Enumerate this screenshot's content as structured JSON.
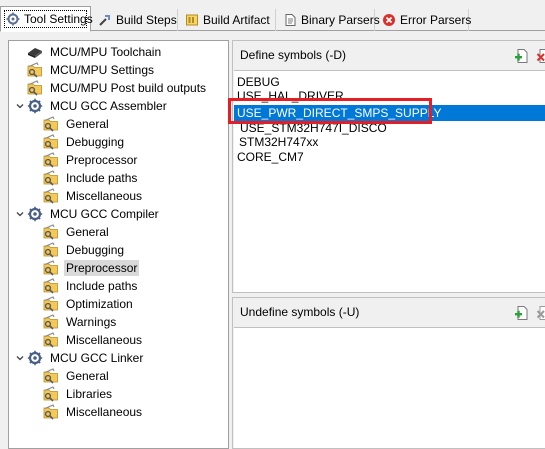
{
  "tabs": [
    {
      "label": "Tool Settings",
      "icon": "tool-settings-icon",
      "active": true
    },
    {
      "label": "Build Steps",
      "icon": "build-steps-icon",
      "active": false
    },
    {
      "label": "Build Artifact",
      "icon": "build-artifact-icon",
      "active": false
    },
    {
      "label": "Binary Parsers",
      "icon": "binary-parsers-icon",
      "active": false
    },
    {
      "label": "Error Parsers",
      "icon": "error-parsers-icon",
      "active": false
    }
  ],
  "tree": [
    {
      "label": "MCU/MPU Toolchain",
      "icon": "chip-icon",
      "level": 0,
      "expand": "none"
    },
    {
      "label": "MCU/MPU Settings",
      "icon": "settings-folder-icon",
      "level": 0,
      "expand": "none"
    },
    {
      "label": "MCU/MPU Post build outputs",
      "icon": "settings-folder-icon",
      "level": 0,
      "expand": "none"
    },
    {
      "label": "MCU GCC Assembler",
      "icon": "tool-gear-icon",
      "level": 0,
      "expand": "open"
    },
    {
      "label": "General",
      "icon": "settings-folder-icon",
      "level": 1,
      "expand": "none"
    },
    {
      "label": "Debugging",
      "icon": "settings-folder-icon",
      "level": 1,
      "expand": "none"
    },
    {
      "label": "Preprocessor",
      "icon": "settings-folder-icon",
      "level": 1,
      "expand": "none"
    },
    {
      "label": "Include paths",
      "icon": "settings-folder-icon",
      "level": 1,
      "expand": "none"
    },
    {
      "label": "Miscellaneous",
      "icon": "settings-folder-icon",
      "level": 1,
      "expand": "none"
    },
    {
      "label": "MCU GCC Compiler",
      "icon": "tool-gear-icon",
      "level": 0,
      "expand": "open"
    },
    {
      "label": "General",
      "icon": "settings-folder-icon",
      "level": 1,
      "expand": "none"
    },
    {
      "label": "Debugging",
      "icon": "settings-folder-icon",
      "level": 1,
      "expand": "none"
    },
    {
      "label": "Preprocessor",
      "icon": "settings-folder-icon",
      "level": 1,
      "expand": "none",
      "selected": true
    },
    {
      "label": "Include paths",
      "icon": "settings-folder-icon",
      "level": 1,
      "expand": "none"
    },
    {
      "label": "Optimization",
      "icon": "settings-folder-icon",
      "level": 1,
      "expand": "none"
    },
    {
      "label": "Warnings",
      "icon": "settings-folder-icon",
      "level": 1,
      "expand": "none"
    },
    {
      "label": "Miscellaneous",
      "icon": "settings-folder-icon",
      "level": 1,
      "expand": "none"
    },
    {
      "label": "MCU GCC Linker",
      "icon": "tool-gear-icon",
      "level": 0,
      "expand": "open"
    },
    {
      "label": "General",
      "icon": "settings-folder-icon",
      "level": 1,
      "expand": "none"
    },
    {
      "label": "Libraries",
      "icon": "settings-folder-icon",
      "level": 1,
      "expand": "none"
    },
    {
      "label": "Miscellaneous",
      "icon": "settings-folder-icon",
      "level": 1,
      "expand": "none"
    }
  ],
  "define_panel": {
    "title": "Define symbols (-D)",
    "symbols": [
      {
        "text": "DEBUG",
        "selected": false
      },
      {
        "text": "USE_HAL_DRIVER",
        "selected": false
      },
      {
        "text": "USE_PWR_DIRECT_SMPS_SUPPLY",
        "selected": true
      },
      {
        "text": "USE_STM32H747I_DISCO",
        "selected": false
      },
      {
        "text": "STM32H747xx",
        "selected": false
      },
      {
        "text": "CORE_CM7",
        "selected": false
      }
    ]
  },
  "undefine_panel": {
    "title": "Undefine symbols (-U)",
    "symbols": []
  },
  "colors": {
    "selection": "#0078d7",
    "highlight_box": "#e51e25",
    "tree_selected": "#d9d9d9"
  }
}
